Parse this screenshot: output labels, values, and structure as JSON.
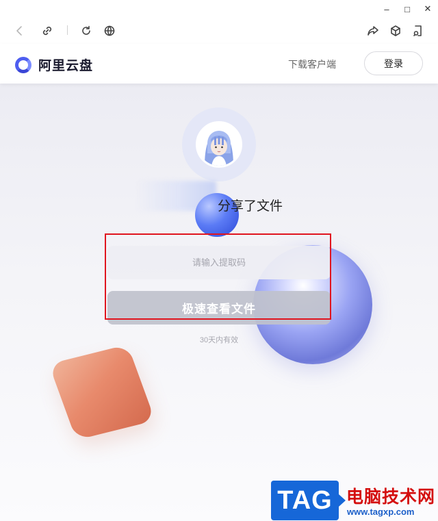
{
  "window": {
    "controls": {
      "minimize": "–",
      "maximize": "□",
      "close": "✕"
    }
  },
  "toolbar": {
    "icons": [
      "back-icon",
      "link-icon",
      "refresh-icon",
      "globe-icon",
      "share-icon",
      "cube-icon",
      "screenshot-icon"
    ]
  },
  "header": {
    "brand": "阿里云盘",
    "download": "下载客户端",
    "login": "登录"
  },
  "share": {
    "text": "分享了文件",
    "code_placeholder": "请输入提取码",
    "code_value": "",
    "view_button": "极速查看文件",
    "validity": "30天内有效"
  },
  "watermark": {
    "tag": "TAG",
    "title": "电脑技术网",
    "url": "www.tagxp.com"
  },
  "colors": {
    "brand": "#4e5ef0",
    "highlight_box": "#e0141e",
    "button_disabled": "#c0c2cc"
  }
}
